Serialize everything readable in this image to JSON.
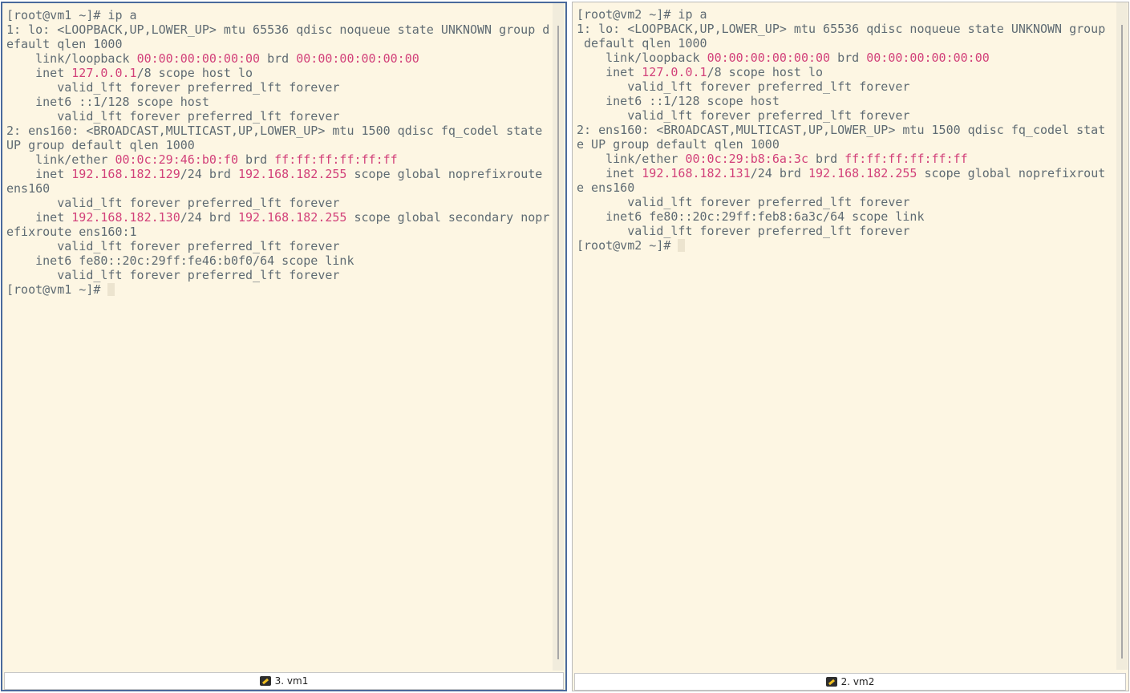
{
  "panes": [
    {
      "tab_label": "3. vm1",
      "icon": "terminal-icon",
      "lines": [
        [
          {
            "t": "[root@vm1 ~]# ip a"
          }
        ],
        [
          {
            "t": "1: lo: <LOOPBACK,UP,LOWER_UP> mtu 65536 qdisc noqueue state UNKNOWN group d"
          }
        ],
        [
          {
            "t": "efault qlen 1000"
          }
        ],
        [
          {
            "t": "    link/loopback "
          },
          {
            "t": "00:00:00:00:00:00",
            "h": true
          },
          {
            "t": " brd "
          },
          {
            "t": "00:00:00:00:00:00",
            "h": true
          }
        ],
        [
          {
            "t": "    inet "
          },
          {
            "t": "127.0.0.1",
            "h": true
          },
          {
            "t": "/8 scope host lo"
          }
        ],
        [
          {
            "t": "       valid_lft forever preferred_lft forever"
          }
        ],
        [
          {
            "t": "    inet6 ::1/128 scope host"
          }
        ],
        [
          {
            "t": "       valid_lft forever preferred_lft forever"
          }
        ],
        [
          {
            "t": "2: ens160: <BROADCAST,MULTICAST,UP,LOWER_UP> mtu 1500 qdisc fq_codel state"
          }
        ],
        [
          {
            "t": "UP group default qlen 1000"
          }
        ],
        [
          {
            "t": "    link/ether "
          },
          {
            "t": "00:0c:29:46:b0:f0",
            "h": true
          },
          {
            "t": " brd "
          },
          {
            "t": "ff:ff:ff:ff:ff:ff",
            "h": true
          }
        ],
        [
          {
            "t": "    inet "
          },
          {
            "t": "192.168.182.129",
            "h": true
          },
          {
            "t": "/24 brd "
          },
          {
            "t": "192.168.182.255",
            "h": true
          },
          {
            "t": " scope global noprefixroute"
          }
        ],
        [
          {
            "t": "ens160"
          }
        ],
        [
          {
            "t": "       valid_lft forever preferred_lft forever"
          }
        ],
        [
          {
            "t": "    inet "
          },
          {
            "t": "192.168.182.130",
            "h": true
          },
          {
            "t": "/24 brd "
          },
          {
            "t": "192.168.182.255",
            "h": true
          },
          {
            "t": " scope global secondary nopr"
          }
        ],
        [
          {
            "t": "efixroute ens160:1"
          }
        ],
        [
          {
            "t": "       valid_lft forever preferred_lft forever"
          }
        ],
        [
          {
            "t": "    inet6 fe80::20c:29ff:fe46:b0f0/64 scope link"
          }
        ],
        [
          {
            "t": "       valid_lft forever preferred_lft forever"
          }
        ],
        [
          {
            "t": "[root@vm1 ~]# "
          },
          {
            "cursor": true
          }
        ]
      ]
    },
    {
      "tab_label": "2. vm2",
      "icon": "terminal-icon",
      "lines": [
        [
          {
            "t": "[root@vm2 ~]# ip a"
          }
        ],
        [
          {
            "t": "1: lo: <LOOPBACK,UP,LOWER_UP> mtu 65536 qdisc noqueue state UNKNOWN group"
          }
        ],
        [
          {
            "t": " default qlen 1000"
          }
        ],
        [
          {
            "t": "    link/loopback "
          },
          {
            "t": "00:00:00:00:00:00",
            "h": true
          },
          {
            "t": " brd "
          },
          {
            "t": "00:00:00:00:00:00",
            "h": true
          }
        ],
        [
          {
            "t": "    inet "
          },
          {
            "t": "127.0.0.1",
            "h": true
          },
          {
            "t": "/8 scope host lo"
          }
        ],
        [
          {
            "t": "       valid_lft forever preferred_lft forever"
          }
        ],
        [
          {
            "t": "    inet6 ::1/128 scope host"
          }
        ],
        [
          {
            "t": "       valid_lft forever preferred_lft forever"
          }
        ],
        [
          {
            "t": "2: ens160: <BROADCAST,MULTICAST,UP,LOWER_UP> mtu 1500 qdisc fq_codel stat"
          }
        ],
        [
          {
            "t": "e UP group default qlen 1000"
          }
        ],
        [
          {
            "t": "    link/ether "
          },
          {
            "t": "00:0c:29:b8:6a:3c",
            "h": true
          },
          {
            "t": " brd "
          },
          {
            "t": "ff:ff:ff:ff:ff:ff",
            "h": true
          }
        ],
        [
          {
            "t": "    inet "
          },
          {
            "t": "192.168.182.131",
            "h": true
          },
          {
            "t": "/24 brd "
          },
          {
            "t": "192.168.182.255",
            "h": true
          },
          {
            "t": " scope global noprefixrout"
          }
        ],
        [
          {
            "t": "e ens160"
          }
        ],
        [
          {
            "t": "       valid_lft forever preferred_lft forever"
          }
        ],
        [
          {
            "t": "    inet6 fe80::20c:29ff:feb8:6a3c/64 scope link"
          }
        ],
        [
          {
            "t": "       valid_lft forever preferred_lft forever"
          }
        ],
        [
          {
            "t": "[root@vm2 ~]# "
          },
          {
            "cursor": true
          }
        ]
      ]
    }
  ],
  "colors": {
    "background": "#fdf6e3",
    "text": "#5f6b73",
    "highlight": "#d2417a",
    "active_border": "#4a6a9c"
  }
}
